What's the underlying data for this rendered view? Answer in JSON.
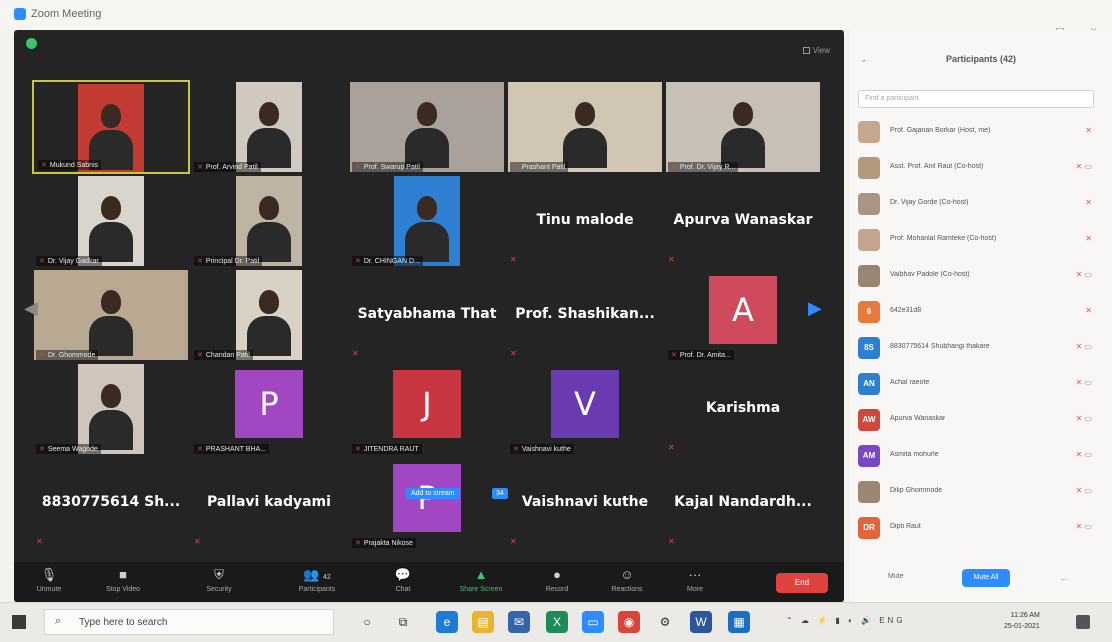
{
  "window": {
    "title": "Zoom Meeting",
    "min_btn": "–",
    "max_btn": "◻",
    "close_btn": "×"
  },
  "meeting": {
    "view_label": "View",
    "nav_prev": "◀",
    "nav_next": "▶",
    "tooltip_text": "Add to stream",
    "tooltip_extra": "34",
    "tiles": [
      {
        "kind": "video",
        "label": "Mukund Sabnis",
        "active": true,
        "bg": "#c23b32"
      },
      {
        "kind": "video",
        "label": "Prof. Arvind Patil",
        "bg": "#cfc9bf"
      },
      {
        "kind": "video",
        "label": "Prof. Swarup Patil",
        "bg": "#a9a29a",
        "wide": true
      },
      {
        "kind": "video",
        "label": "Prashant Patil",
        "bg": "#cfc6b4",
        "wide": true
      },
      {
        "kind": "video",
        "label": "Prof. Dr. Vijay R...",
        "bg": "#c6c0b6",
        "wide": true
      },
      {
        "kind": "video",
        "label": "Dr. Vijay Gadkar",
        "bg": "#d9d5cc"
      },
      {
        "kind": "video",
        "label": "Principal Dr. Patil",
        "bg": "#bfb3a3"
      },
      {
        "kind": "video",
        "label": "Dr. CHINGAN D...",
        "bg": "#2f7fd3"
      },
      {
        "kind": "name",
        "name": "Tinu malode"
      },
      {
        "kind": "name",
        "name": "Apurva Wanaskar"
      },
      {
        "kind": "video",
        "label": "Dr. Ghommode",
        "bg": "#b9a992",
        "wide": true
      },
      {
        "kind": "video",
        "label": "Chandan Patil",
        "bg": "#d8d1c4"
      },
      {
        "kind": "name",
        "name": "Satyabhama That"
      },
      {
        "kind": "name",
        "name": "Prof. Shashikan..."
      },
      {
        "kind": "avatar",
        "letter": "A",
        "color": "#d04a5e",
        "label": "Prof. Dr. Amita..."
      },
      {
        "kind": "video",
        "label": "Seema Wagode",
        "bg": "#cfc5bc"
      },
      {
        "kind": "avatar",
        "letter": "P",
        "color": "#a247c4",
        "label": "PRASHANT BHA..."
      },
      {
        "kind": "avatar",
        "letter": "J",
        "color": "#c9363f",
        "label": "JITENDRA RAUT"
      },
      {
        "kind": "avatar",
        "letter": "V",
        "color": "#6a3ab1",
        "label": "Vaishnavi kuthe"
      },
      {
        "kind": "name",
        "name": "Karishma"
      },
      {
        "kind": "name",
        "name": "8830775614 Sh..."
      },
      {
        "kind": "name",
        "name": "Pallavi kadyami"
      },
      {
        "kind": "avatar",
        "letter": "P",
        "color": "#a247c4",
        "label": "Prajakta Nikose"
      },
      {
        "kind": "name",
        "name": "Vaishnavi kuthe"
      },
      {
        "kind": "name",
        "name": "Kajal  Nandardh..."
      }
    ]
  },
  "toolbar": {
    "unmute": "Unmute",
    "stop_video": "Stop Video",
    "security": "Security",
    "participants": "Participants",
    "participants_count": "42",
    "chat": "Chat",
    "share_screen": "Share Screen",
    "record": "Record",
    "reactions": "Reactions",
    "more": "More",
    "end": "End"
  },
  "panel": {
    "title": "Participants (42)",
    "search_placeholder": "Find a participant",
    "participants": [
      {
        "name": "Prof. Gajanan Borkar (Host, me)",
        "initials": "",
        "color": "#c7a88f",
        "video_off": false
      },
      {
        "name": "Asst. Prof. Anil Raut (Co-host)",
        "initials": "",
        "color": "#b49a7c",
        "video_off": true
      },
      {
        "name": "Dr. Vijay Gorde (Co-host)",
        "initials": "",
        "color": "#a99580",
        "video_off": false
      },
      {
        "name": "Prof. Mohanlal Ramteke (Co-host)",
        "initials": "",
        "color": "#c2a58c",
        "video_off": false
      },
      {
        "name": "Vaibhav Padole (Co-host)",
        "initials": "",
        "color": "#9a8572",
        "video_off": true
      },
      {
        "name": "642e31d8",
        "initials": "6",
        "color": "#e67a3a",
        "video_off": false
      },
      {
        "name": "8830775614 Shubhangi thakare",
        "initials": "8S",
        "color": "#2d7fd0",
        "video_off": true
      },
      {
        "name": "Achal raeote",
        "initials": "AN",
        "color": "#2d7fd0",
        "video_off": true
      },
      {
        "name": "Apurva Wanaskar",
        "initials": "AW",
        "color": "#d0473e",
        "video_off": true
      },
      {
        "name": "Asmita mohurle",
        "initials": "AM",
        "color": "#7a48c4",
        "video_off": true
      },
      {
        "name": "Dilip Ghommode",
        "initials": "",
        "color": "#9c8672",
        "video_off": true
      },
      {
        "name": "Dipti Raut",
        "initials": "DR",
        "color": "#e0653a",
        "video_off": true
      }
    ],
    "mute_all": "Mute",
    "unmute_all": "Mute All",
    "more": "..."
  },
  "taskbar": {
    "search_placeholder": "Type here to search",
    "time": "11:26 AM",
    "date": "25-01-2021",
    "lang": "ENG"
  }
}
